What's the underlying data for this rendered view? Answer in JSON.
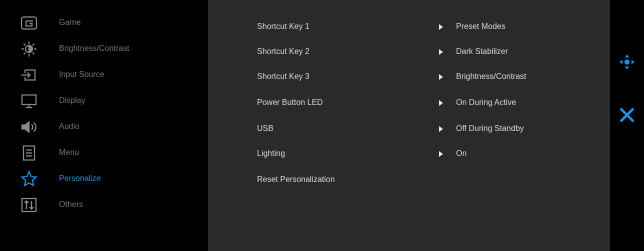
{
  "sidebar": {
    "items": [
      {
        "label": "Game",
        "icon": "game-icon"
      },
      {
        "label": "Brightness/Contrast",
        "icon": "brightness-icon"
      },
      {
        "label": "Input Source",
        "icon": "input-source-icon"
      },
      {
        "label": "Display",
        "icon": "display-icon"
      },
      {
        "label": "Audio",
        "icon": "audio-icon"
      },
      {
        "label": "Menu",
        "icon": "menu-icon"
      },
      {
        "label": "Personalize",
        "icon": "star-icon",
        "active": true
      },
      {
        "label": "Others",
        "icon": "others-icon"
      }
    ]
  },
  "panel": {
    "rows": [
      {
        "label": "Shortcut Key 1",
        "value": "Preset Modes"
      },
      {
        "label": "Shortcut Key 2",
        "value": "Dark Stabilizer"
      },
      {
        "label": "Shortcut Key 3",
        "value": "Brightness/Contrast"
      },
      {
        "label": "Power Button LED",
        "value": "On During Active"
      },
      {
        "label": "USB",
        "value": "Off During Standby"
      },
      {
        "label": "Lighting",
        "value": "On"
      },
      {
        "label": "Reset Personalization",
        "value": ""
      }
    ]
  },
  "controls": {
    "navigate_icon": "joystick-navigate-icon",
    "exit_icon": "close-icon"
  },
  "colors": {
    "accent": "#1e8fe6",
    "panel_bg": "#2a2a2a",
    "background": "#000000",
    "inactive_text": "#777777",
    "text": "#d8d8d8"
  }
}
